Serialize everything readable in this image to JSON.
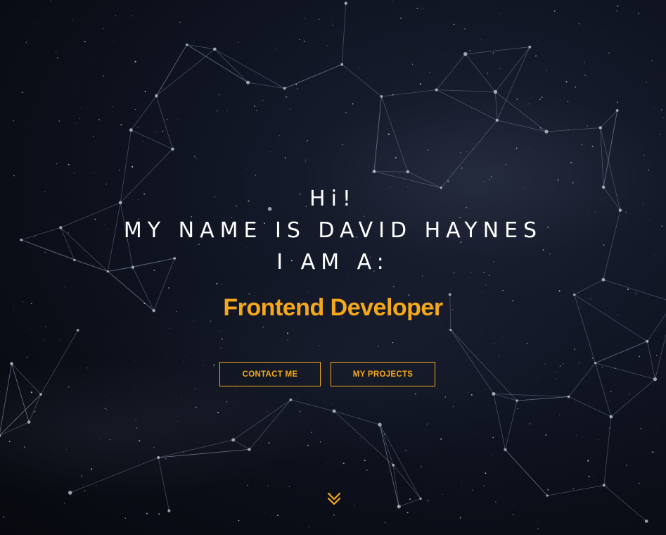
{
  "hero": {
    "greeting": "Hi!",
    "name_line": "MY NAME IS DAVID HAYNES",
    "role_intro": "I AM A:",
    "role": "Frontend Developer"
  },
  "actions": {
    "contact_label": "CONTACT ME",
    "projects_label": "MY PROJECTS"
  },
  "scroll": {
    "icon": "double-chevron-down-icon"
  },
  "colors": {
    "accent": "#f5a81b",
    "text": "#ffffff",
    "background": "#0e121d",
    "network_lines": "#8a93a8"
  }
}
